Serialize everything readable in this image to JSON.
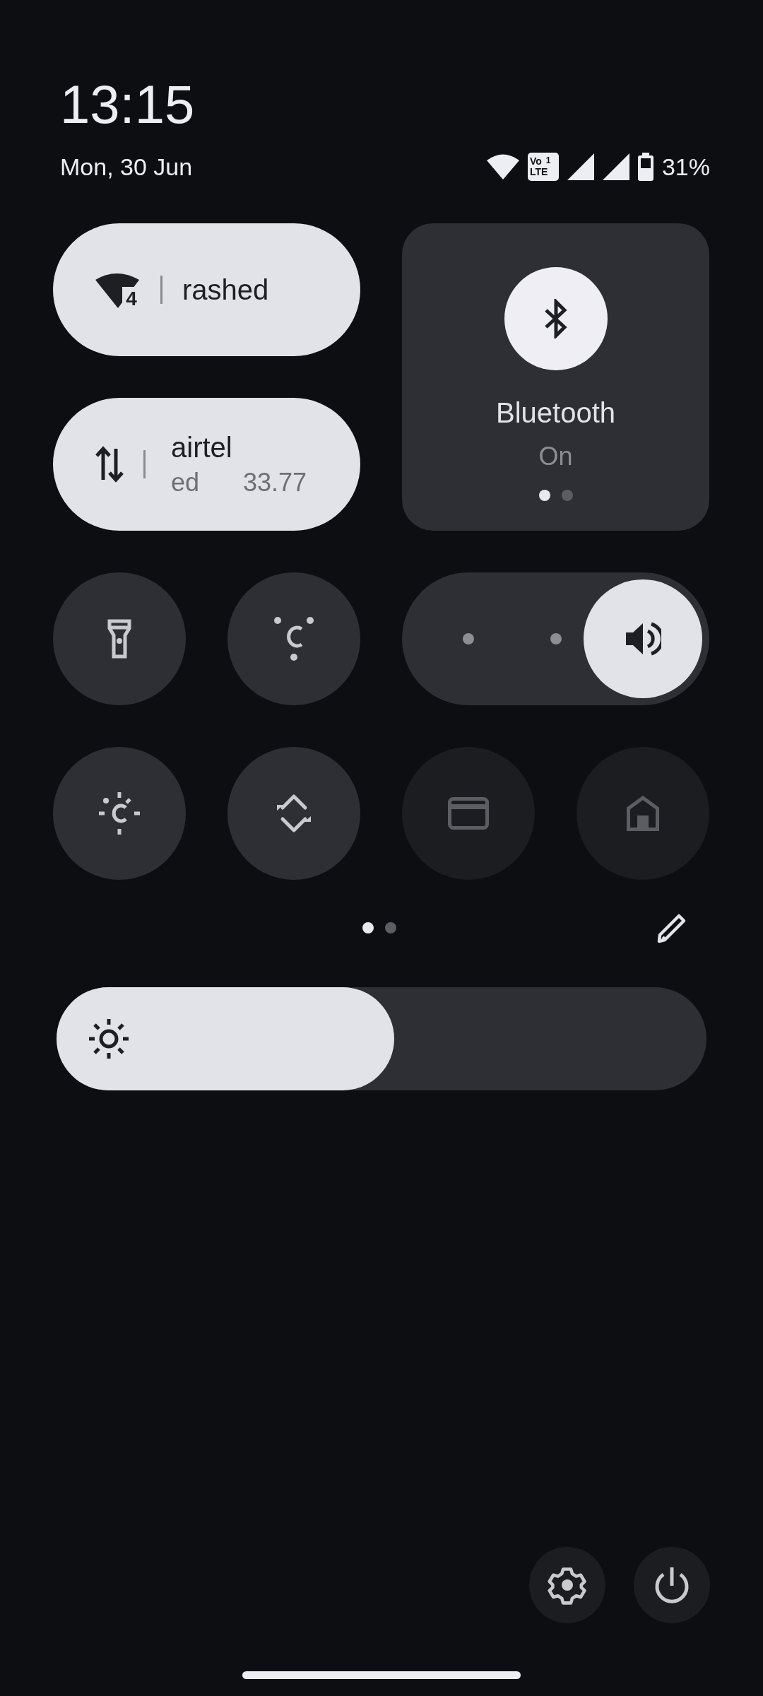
{
  "header": {
    "time": "13:15",
    "date": "Mon, 30 Jun",
    "volte": {
      "top": "Vo",
      "bottom": "LTE",
      "sim": "1"
    },
    "battery": "31%"
  },
  "wifi_tile": {
    "label": "rashed",
    "standard": "4",
    "on": true
  },
  "mobile_tile": {
    "label": "airtel",
    "secondary": [
      "ed",
      "33.77"
    ],
    "on": true
  },
  "bluetooth_tile": {
    "label": "Bluetooth",
    "status": "On",
    "on": true,
    "pages": [
      {
        "selected": true
      },
      {
        "selected": false
      }
    ]
  },
  "small_tiles": [
    {
      "kind": "flashlight",
      "on": false,
      "disabled": false
    },
    {
      "kind": "color-correction",
      "on": false,
      "disabled": false
    }
  ],
  "volume": {
    "level": 1
  },
  "tiles_row": [
    {
      "kind": "night-light",
      "on": false,
      "disabled": false
    },
    {
      "kind": "auto-rotate",
      "on": false,
      "disabled": false
    },
    {
      "kind": "wallet",
      "on": false,
      "disabled": true
    },
    {
      "kind": "home",
      "on": false,
      "disabled": true
    }
  ],
  "pages": [
    {
      "selected": true
    },
    {
      "selected": false
    }
  ],
  "brightness": {
    "level": 0.52
  }
}
